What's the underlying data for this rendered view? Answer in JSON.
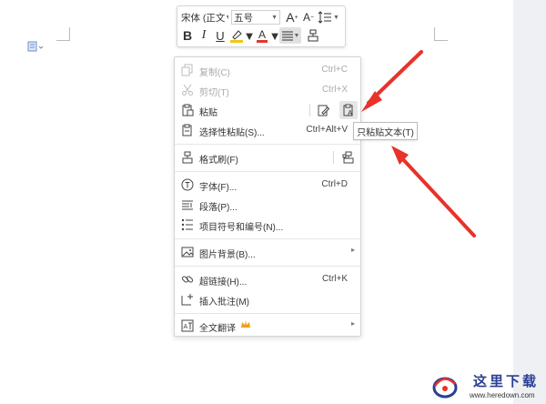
{
  "toolbar": {
    "font_name": "宋体 (正文",
    "font_size": "五号",
    "increase_font_label": "A",
    "decrease_font_label": "A",
    "bold_label": "B",
    "italic_label": "I",
    "underline_label": "U",
    "font_color_label": "A",
    "highlight_color": "#f5c518",
    "font_color": "#e0372a"
  },
  "context_menu": {
    "items": [
      {
        "label": "复制(C)",
        "shortcut": "Ctrl+C",
        "icon": "copy-icon",
        "enabled": false
      },
      {
        "label": "剪切(T)",
        "shortcut": "Ctrl+X",
        "icon": "cut-icon",
        "enabled": false
      },
      {
        "label": "粘贴",
        "shortcut": "",
        "icon": "paste-icon",
        "enabled": true
      },
      {
        "label": "选择性粘贴(S)...",
        "shortcut": "Ctrl+Alt+V",
        "icon": "paste-special-icon",
        "enabled": true
      },
      {
        "label": "格式刷(F)",
        "shortcut": "",
        "icon": "format-painter-icon",
        "enabled": true
      },
      {
        "label": "字体(F)...",
        "shortcut": "Ctrl+D",
        "icon": "font-icon",
        "enabled": true
      },
      {
        "label": "段落(P)...",
        "shortcut": "",
        "icon": "paragraph-icon",
        "enabled": true
      },
      {
        "label": "项目符号和编号(N)...",
        "shortcut": "",
        "icon": "bullet-list-icon",
        "enabled": true
      },
      {
        "label": "图片背景(B)...",
        "shortcut": "",
        "icon": "picture-background-icon",
        "enabled": true
      },
      {
        "label": "超链接(H)...",
        "shortcut": "Ctrl+K",
        "icon": "hyperlink-icon",
        "enabled": true
      },
      {
        "label": "插入批注(M)",
        "shortcut": "",
        "icon": "insert-comment-icon",
        "enabled": true
      },
      {
        "label": "全文翻译",
        "shortcut": "",
        "icon": "translate-icon",
        "enabled": true
      }
    ]
  },
  "tooltip": {
    "text": "只粘贴文本(T)"
  },
  "watermark": {
    "title": "这里下载",
    "url": "www.heredown.com"
  },
  "colors": {
    "arrow": "#e8322a",
    "accent_crown": "#f0a020"
  }
}
